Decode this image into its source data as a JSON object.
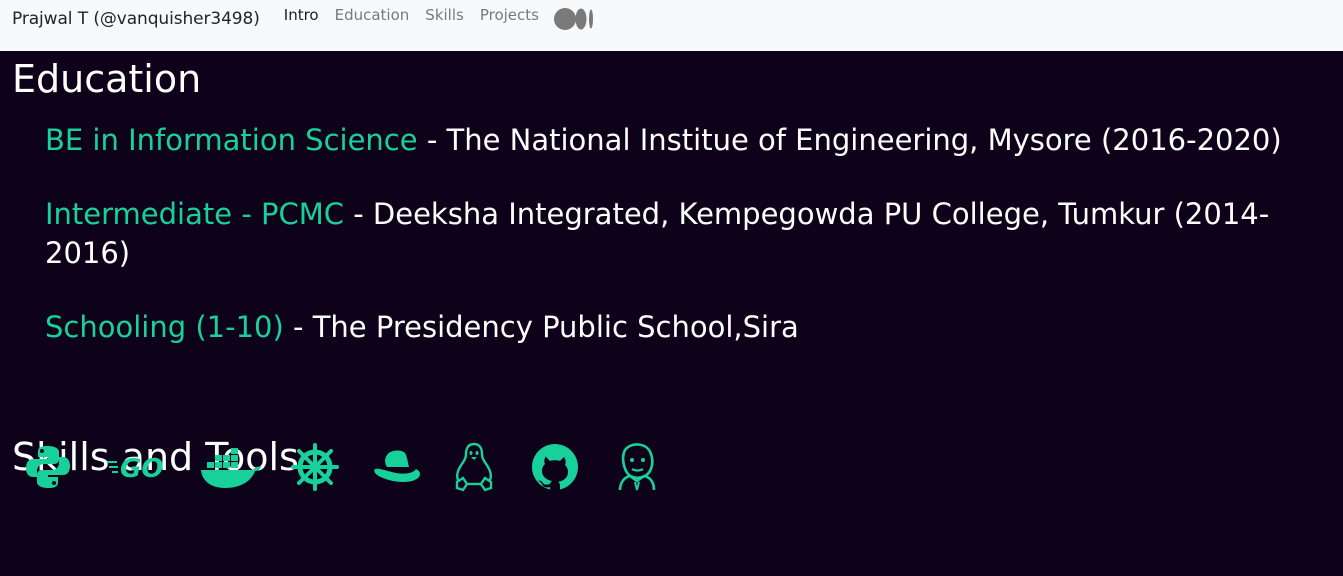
{
  "navbar": {
    "brand": "Prajwal T (@vanquisher3498)",
    "links": [
      {
        "label": "Intro",
        "active": true
      },
      {
        "label": "Education",
        "active": false
      },
      {
        "label": "Skills",
        "active": false
      },
      {
        "label": "Projects",
        "active": false
      }
    ],
    "medium_icon": "medium-icon"
  },
  "education": {
    "title": "Education",
    "items": [
      {
        "degree": "BE in Information Science",
        "detail": " - The National Institue of Engineering, Mysore (2016-2020)"
      },
      {
        "degree": "Intermediate - PCMC",
        "detail": " - Deeksha Integrated, Kempegowda PU College, Tumkur (2014-2016)"
      },
      {
        "degree": "Schooling (1-10)",
        "detail": " - The Presidency Public School,Sira"
      }
    ]
  },
  "skills": {
    "title": "Skills and Tools",
    "icons": [
      "python-icon",
      "go-icon",
      "docker-icon",
      "kubernetes-icon",
      "redhat-icon",
      "linux-icon",
      "github-icon",
      "jenkins-icon"
    ]
  },
  "colors": {
    "background": "#0d0219",
    "accent": "#18d19a",
    "navbar_bg": "#f8f9fa"
  }
}
